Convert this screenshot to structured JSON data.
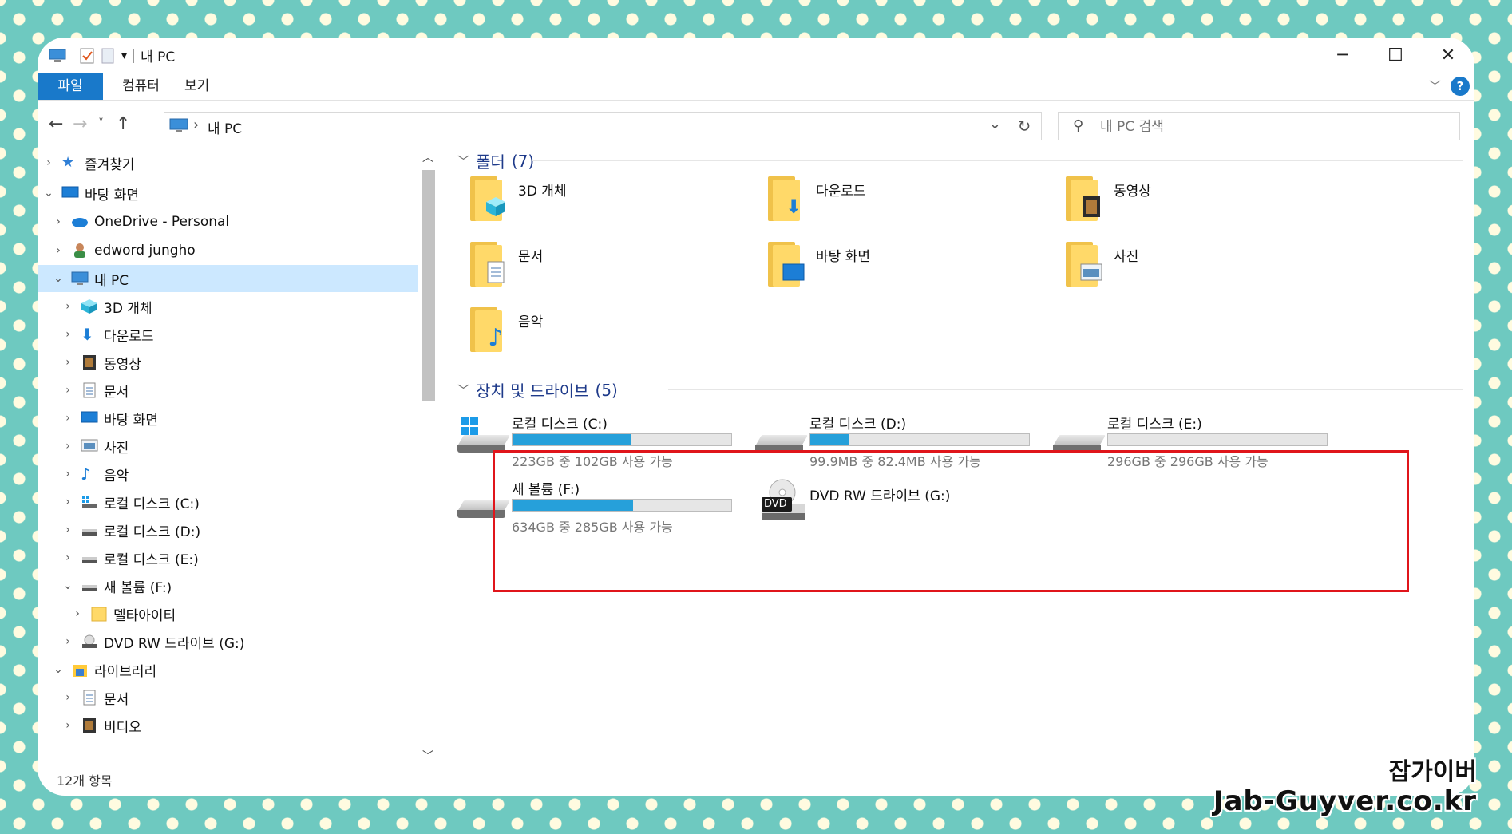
{
  "window": {
    "title": "내 PC",
    "controls": {
      "minimize": "─",
      "maximize": "☐",
      "close": "✕"
    }
  },
  "ribbon": {
    "tabs": [
      "파일",
      "컴퓨터",
      "보기"
    ],
    "help": "?"
  },
  "navbar": {
    "address": "내 PC",
    "search_placeholder": "내 PC 검색"
  },
  "tree": [
    {
      "label": "즐겨찾기",
      "icon": "star-icon",
      "expanded": false
    },
    {
      "label": "바탕 화면",
      "icon": "desktop-icon",
      "expanded": true
    },
    {
      "label": "OneDrive - Personal",
      "icon": "cloud-icon",
      "expanded": false
    },
    {
      "label": "edword jungho",
      "icon": "user-icon",
      "expanded": false
    },
    {
      "label": "내 PC",
      "icon": "computer-icon",
      "expanded": true,
      "selected": true
    },
    {
      "label": "3D 개체",
      "icon": "cube-icon",
      "expanded": false
    },
    {
      "label": "다운로드",
      "icon": "download-icon",
      "expanded": false
    },
    {
      "label": "동영상",
      "icon": "film-icon",
      "expanded": false
    },
    {
      "label": "문서",
      "icon": "document-icon",
      "expanded": false
    },
    {
      "label": "바탕 화면",
      "icon": "desktop-icon",
      "expanded": false
    },
    {
      "label": "사진",
      "icon": "picture-icon",
      "expanded": false
    },
    {
      "label": "음악",
      "icon": "music-icon",
      "expanded": false
    },
    {
      "label": "로컬 디스크 (C:)",
      "icon": "windows-drive-icon",
      "expanded": false
    },
    {
      "label": "로컬 디스크 (D:)",
      "icon": "drive-icon",
      "expanded": false
    },
    {
      "label": "로컬 디스크 (E:)",
      "icon": "drive-icon",
      "expanded": false
    },
    {
      "label": "새 볼륨 (F:)",
      "icon": "drive-icon",
      "expanded": true
    },
    {
      "label": "델타아이티",
      "icon": "folder-icon",
      "expanded": false
    },
    {
      "label": "DVD RW 드라이브 (G:)",
      "icon": "dvd-icon",
      "expanded": false
    },
    {
      "label": "라이브러리",
      "icon": "library-icon",
      "expanded": true
    },
    {
      "label": "문서",
      "icon": "document-icon",
      "expanded": false
    },
    {
      "label": "비디오",
      "icon": "film-icon",
      "expanded": false
    }
  ],
  "folders_group": {
    "title": "폴더",
    "count": "(7)",
    "items": [
      {
        "label": "3D 개체",
        "icon": "cube-icon"
      },
      {
        "label": "다운로드",
        "icon": "download-icon"
      },
      {
        "label": "동영상",
        "icon": "film-icon"
      },
      {
        "label": "문서",
        "icon": "document-icon"
      },
      {
        "label": "바탕 화면",
        "icon": "desktop-icon"
      },
      {
        "label": "사진",
        "icon": "picture-icon"
      },
      {
        "label": "음악",
        "icon": "music-icon"
      }
    ]
  },
  "drives_group": {
    "title": "장치 및 드라이브",
    "count": "(5)",
    "items": [
      {
        "label": "로컬 디스크 (C:)",
        "usage": "223GB 중 102GB 사용 가능",
        "used_fraction": 0.54,
        "icon": "windows-drive-icon"
      },
      {
        "label": "로컬 디스크 (D:)",
        "usage": "99.9MB 중 82.4MB 사용 가능",
        "used_fraction": 0.18,
        "icon": "drive-icon"
      },
      {
        "label": "로컬 디스크 (E:)",
        "usage": "296GB 중 296GB 사용 가능",
        "used_fraction": 0.0,
        "icon": "drive-icon"
      },
      {
        "label": "새 볼륨 (F:)",
        "usage": "634GB 중 285GB 사용 가능",
        "used_fraction": 0.55,
        "icon": "drive-icon"
      },
      {
        "label": "DVD RW 드라이브 (G:)",
        "usage": "",
        "icon": "dvd-icon",
        "badge": "DVD"
      }
    ]
  },
  "status": {
    "item_count": "12개 항목"
  },
  "watermark": {
    "line1": "잡가이버",
    "line2": "Jab-Guyver.co.kr"
  },
  "colors": {
    "accent": "#1979ca",
    "selection": "#cce8ff",
    "bar_fill": "#26a0da",
    "highlight_box": "#e0151b",
    "group_title": "#1e3a8a"
  }
}
